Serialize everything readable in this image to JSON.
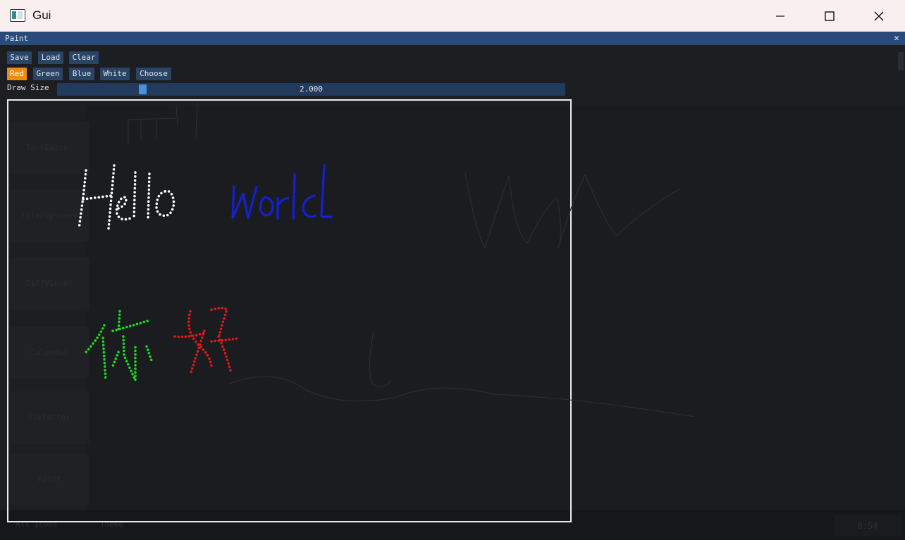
{
  "window": {
    "title": "Gui"
  },
  "paint": {
    "title": "Paint",
    "toolbar": {
      "save": "Save",
      "load": "Load",
      "clear": "Clear"
    },
    "colors": {
      "red": "Red",
      "green": "Green",
      "blue": "Blue",
      "white": "White",
      "choose": "Choose",
      "selected": "Red"
    },
    "draw_size": {
      "label": "Draw Size",
      "value": "2.000",
      "min": 0,
      "max": 40,
      "numeric": 2.0
    },
    "strokes": [
      {
        "text": "Hello",
        "color": "#ffffff"
      },
      {
        "text": "world",
        "color": "#1520d8"
      },
      {
        "text": "你",
        "color": "#1ddc1d"
      },
      {
        "text": "好",
        "color": "#e21a1a"
      }
    ]
  },
  "background_app": {
    "sidebar": [
      "TextEditor",
      "FileExplorer",
      "DiffViewer",
      "Calendar",
      "CsvEditor",
      "Paint"
    ],
    "bottom_tabs": [
      "All Icons",
      "Theme"
    ],
    "clock": "8:54"
  },
  "colors": {
    "accent": "#294a7a",
    "button": "#2a4466",
    "selected": "#f08a12",
    "canvas_border": "#ededed"
  }
}
